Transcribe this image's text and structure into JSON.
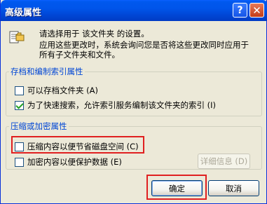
{
  "window": {
    "title": "高级属性"
  },
  "title_buttons": {
    "help": "?",
    "close": "✕"
  },
  "intro": {
    "line1": "请选择用于 该文件夹 的设置。",
    "line2": "应用这些更改时，系统会询问您是否将这些更改同时应用于",
    "line3": "所有子文件夹和文件。",
    "icon": "folder-properties-icon"
  },
  "archive_group": {
    "legend": "存档和编制索引属性",
    "items": [
      {
        "label": "可以存档文件夹 (A)",
        "checked": false
      },
      {
        "label": "为了快速搜索，允许索引服务编制该文件夹的索引 (I)",
        "checked": true
      }
    ]
  },
  "compress_group": {
    "legend": "压缩或加密属性",
    "items": [
      {
        "label": "压缩内容以便节省磁盘空间 (C)",
        "checked": false
      },
      {
        "label": "加密内容以便保护数据 (E)",
        "checked": false
      }
    ],
    "details_button": "详细信息 (D)"
  },
  "buttons": {
    "ok": "确定",
    "cancel": "取消"
  },
  "colors": {
    "title_bar": "#0055ea",
    "highlight": "#e02020",
    "legend": "#0046d5",
    "window_bg": "#ece9d8"
  }
}
